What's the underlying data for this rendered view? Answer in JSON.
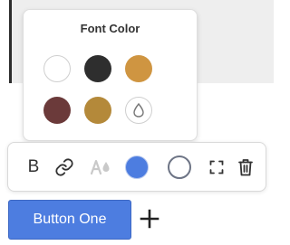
{
  "popover": {
    "title": "Font Color",
    "swatches": [
      {
        "name": "white",
        "color": "#ffffff"
      },
      {
        "name": "black",
        "color": "#2e2e2e"
      },
      {
        "name": "orange",
        "color": "#cf9541"
      },
      {
        "name": "maroon",
        "color": "#6b3a3a"
      },
      {
        "name": "gold",
        "color": "#b4893a"
      },
      {
        "name": "transparent",
        "icon": "droplet-icon"
      }
    ]
  },
  "toolbar": {
    "bold_label": "B",
    "icons": [
      "bold-icon",
      "link-icon",
      "text-style-icon",
      "text-color-swatch",
      "background-color-swatch",
      "fullscreen-icon",
      "trash-icon"
    ],
    "text_color": "#4d7de0",
    "background_color": "#ffffff"
  },
  "button": {
    "label": "Button One",
    "color": "#4d7de0"
  },
  "add_icon": "plus-icon"
}
